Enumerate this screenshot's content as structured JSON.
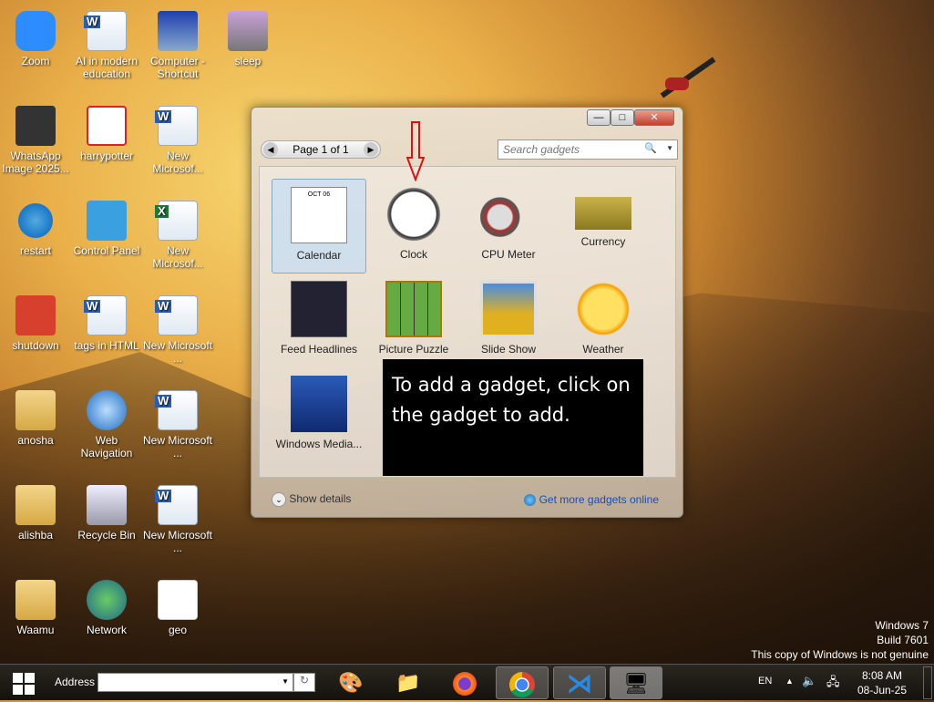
{
  "desktop": {
    "icons": [
      {
        "label": "Zoom",
        "type": "zoom"
      },
      {
        "label": "AI in modern education",
        "type": "word"
      },
      {
        "label": "Computer - Shortcut",
        "type": "computer"
      },
      {
        "label": "sleep",
        "type": "drive"
      },
      {
        "label": "WhatsApp Image 2025...",
        "type": "image"
      },
      {
        "label": "harrypotter",
        "type": "pdf"
      },
      {
        "label": "New Microsof...",
        "type": "word"
      },
      {
        "label": "restart",
        "type": "restart"
      },
      {
        "label": "Control Panel",
        "type": "control"
      },
      {
        "label": "New Microsof...",
        "type": "excel"
      },
      {
        "label": "shutdown",
        "type": "shutdown"
      },
      {
        "label": "tags in HTML",
        "type": "word"
      },
      {
        "label": "New Microsoft ...",
        "type": "word"
      },
      {
        "label": "anosha",
        "type": "folder"
      },
      {
        "label": "Web Navigation",
        "type": "globe"
      },
      {
        "label": "New Microsoft ...",
        "type": "word"
      },
      {
        "label": "alishba",
        "type": "folder"
      },
      {
        "label": "Recycle Bin",
        "type": "recycle"
      },
      {
        "label": "New Microsoft ...",
        "type": "word"
      },
      {
        "label": "Waamu",
        "type": "folder"
      },
      {
        "label": "Network",
        "type": "network"
      },
      {
        "label": "geo",
        "type": "ppt"
      }
    ]
  },
  "dialog": {
    "minimize": "—",
    "maximize": "□",
    "close": "✕",
    "page": "Page 1 of 1",
    "prev": "◀",
    "next": "▶",
    "search_placeholder": "Search gadgets",
    "search_icon": "🔍",
    "gadgets": [
      {
        "label": "Calendar"
      },
      {
        "label": "Clock"
      },
      {
        "label": "CPU Meter"
      },
      {
        "label": "Currency"
      },
      {
        "label": "Feed Headlines"
      },
      {
        "label": "Picture Puzzle"
      },
      {
        "label": "Slide Show"
      },
      {
        "label": "Weather"
      },
      {
        "label": "Windows Media..."
      }
    ],
    "calendar_month": "OCT 06",
    "show_details": "Show details",
    "get_more": "Get more gadgets online"
  },
  "annotation": "To add a gadget, click on the gadget to add.",
  "watermark": {
    "line1": "Windows 7",
    "line2": "Build 7601",
    "line3": "This copy of Windows is not genuine"
  },
  "taskbar": {
    "address_label": "Address",
    "address_value": "",
    "lang": "EN",
    "time": "8:08 AM",
    "date": "08-Jun-25"
  }
}
